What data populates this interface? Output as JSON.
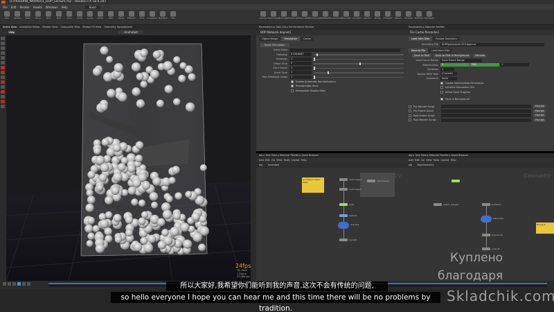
{
  "window": {
    "title": "D:/HOUDINI_WORK/01_DOP_Lecture.hip - Houdini FX 18.0.287"
  },
  "menubar": [
    "File",
    "Edit",
    "Render",
    "Assets",
    "Windows",
    "Help"
  ],
  "desktop": "Build",
  "shelf_left": [
    "Box",
    "Sphere",
    "Tube",
    "Torus",
    "Grid",
    "Null",
    "Line",
    "Circle",
    "Curve",
    "Draw",
    "Path",
    "Spray",
    "Platonic",
    "Font",
    "L-System",
    "Metaball",
    "File"
  ],
  "shelf_right": [
    "Camera",
    "Point Light",
    "Spot Light",
    "Area Light",
    "Geo Light",
    "Volume Light",
    "Distant",
    "Environment",
    "Sky Light",
    "GI Light",
    "Caustic",
    "Portal",
    "Ambient",
    "Stereo",
    "VR Cam",
    "Switcher",
    "Gamepad"
  ],
  "viewport": {
    "tabs": [
      "Scene View",
      "Animation Editor",
      "Render View",
      "Composite View",
      "Motion FX View",
      "Geometry Spreadsheet"
    ],
    "path": "obj",
    "context": "Animated",
    "label": "View",
    "fps": "24fps",
    "stats": [
      "35.78ms",
      "1 frame",
      "27.38k pts"
    ]
  },
  "mid_pane": {
    "tabs": "Parameters ▸ Take List ▸ Performance Monitor",
    "header": "DOP Network  dopnet1",
    "subtabs": [
      "Object Merge",
      "Simulation",
      "Cache"
    ],
    "reset_button": "Reset Simulation",
    "params": [
      {
        "label": "Initial State",
        "value": ""
      },
      {
        "label": "Timestep",
        "value": "0.0416667"
      },
      {
        "label": "Substeps",
        "value": "1"
      },
      {
        "label": "Offset Time",
        "value": "0"
      },
      {
        "label": "Start Frame",
        "value": "1"
      },
      {
        "label": "Scale Time",
        "value": "1"
      },
      {
        "label": "Max Feedback Loops",
        "value": "1"
      }
    ],
    "checks": [
      {
        "label": "Enable Automatic Reinitialization",
        "on": true
      },
      {
        "label": "Provide Data Hints",
        "on": true
      },
      {
        "label": "Interpolate Display Data",
        "on": false
      }
    ]
  },
  "right_pane": {
    "tabs": "Parameters ▸ Material Palette",
    "header": "File Cache  filecache1",
    "subtabs": [
      "Load from Disk",
      "Reload Geometry"
    ],
    "geometry_file_label": "Geometry File",
    "geometry_file": "$HIP/geo/cache.$F4.bgeo.sc",
    "save_tabs": [
      "Save to File",
      "Load from Disk"
    ],
    "save_buttons": [
      "Save to Disk",
      "Save to Disk in Background",
      "Validate"
    ],
    "valid_frame_range_label": "Valid Frame Range",
    "valid_frame_range": "Save Frame Range",
    "start_end_label": "Start/End/Inc",
    "start": "1",
    "end": "240",
    "inc": "1",
    "substeps_label": "Substeps",
    "substeps": "1",
    "render_with_take_label": "Render With Take",
    "render_with_take": "(Current)",
    "transform_label": "Transform",
    "transform": "None",
    "checks": [
      "Create Intermediate Directories",
      "Initialize Simulation OPs",
      "Alfred Style Progress"
    ],
    "save_to_background": "Save in Background",
    "scripts": [
      "Pre-Render Script",
      "Pre-Frame Script",
      "Post-Frame Script",
      "Post-Render Script"
    ],
    "script_lang": "Hscript"
  },
  "net_left": {
    "tabs": "obj ▸ Tree View ▸ Material Palette ▸ Asset Browser",
    "menu": [
      "Add",
      "Edit",
      "Go",
      "View",
      "Tools",
      "Layout",
      "Help"
    ],
    "path": "obj",
    "context": "Animated",
    "context_label": "Geometry",
    "sticky": "Animated: Initial state",
    "nodes": [
      "deformsop1",
      "deformsop2",
      "deformsop3",
      "null1",
      "switch1",
      "dopnet1",
      "ropnet1",
      "output1"
    ]
  },
  "net_right": {
    "tabs": "obj ▸ Tree View ▸ Material Palette ▸ Asset Browser",
    "menu": [
      "Add",
      "Edit",
      "Go",
      "View",
      "Tools",
      "Layout",
      "Help"
    ],
    "path": "obj",
    "context": "BoxGeometry",
    "context_label": "Geometry",
    "sticky": "Box/grid",
    "nodes": [
      "object_merge1",
      "boolean1",
      "filecache1",
      "transform1",
      "output1"
    ]
  },
  "timeline": {
    "frame": "240"
  },
  "subtitles": {
    "cn": "所以大家好,我希望你们能听到我的声音,这次不会有传统的问题,",
    "en": "so hello everyone I hope you can hear me and this time there will be no problems by tradition."
  },
  "watermark": {
    "line1": "Куплено",
    "line2": "благодаря",
    "line3": "Skladchik.com"
  }
}
